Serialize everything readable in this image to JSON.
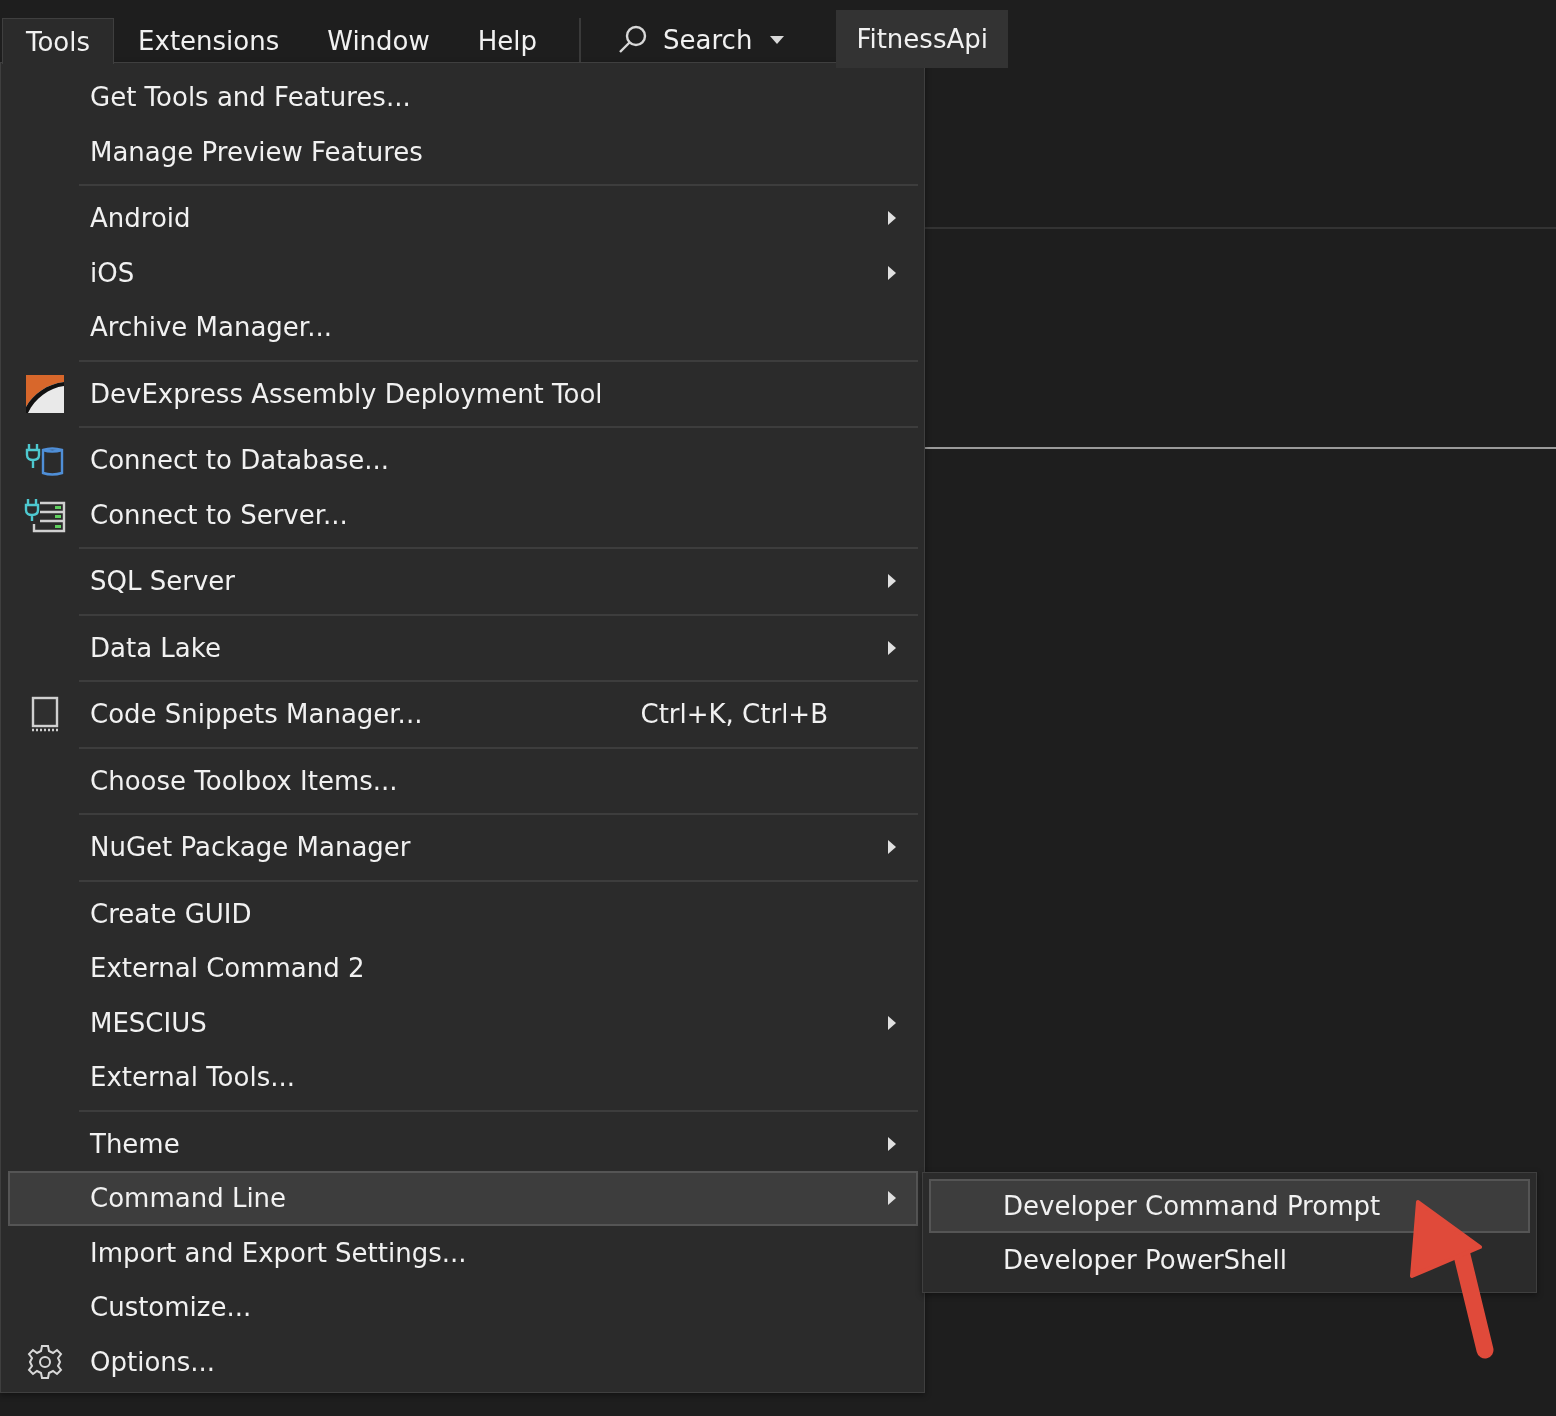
{
  "menubar": {
    "items": [
      {
        "label": "Tools",
        "selected": true
      },
      {
        "label": "Extensions",
        "selected": false
      },
      {
        "label": "Window",
        "selected": false
      },
      {
        "label": "Help",
        "selected": false
      }
    ],
    "search": {
      "label": "Search"
    },
    "solution_title": "FitnessApi"
  },
  "tools_menu": {
    "items": [
      {
        "kind": "item",
        "label": "Get Tools and Features...",
        "selected": false
      },
      {
        "kind": "item",
        "label": "Manage Preview Features",
        "selected": false
      },
      {
        "kind": "separator"
      },
      {
        "kind": "item",
        "label": "Android",
        "submenu": true,
        "selected": false
      },
      {
        "kind": "item",
        "label": "iOS",
        "submenu": true,
        "selected": false
      },
      {
        "kind": "item",
        "label": "Archive Manager...",
        "selected": false
      },
      {
        "kind": "separator"
      },
      {
        "kind": "item",
        "label": "DevExpress Assembly Deployment Tool",
        "selected": false
      },
      {
        "kind": "separator"
      },
      {
        "kind": "item",
        "label": "Connect to Database...",
        "selected": false
      },
      {
        "kind": "item",
        "label": "Connect to Server...",
        "selected": false
      },
      {
        "kind": "separator"
      },
      {
        "kind": "item",
        "label": "SQL Server",
        "submenu": true,
        "selected": false
      },
      {
        "kind": "separator"
      },
      {
        "kind": "item",
        "label": "Data Lake",
        "submenu": true,
        "selected": false
      },
      {
        "kind": "separator"
      },
      {
        "kind": "item",
        "label": "Code Snippets Manager...",
        "shortcut": "Ctrl+K, Ctrl+B",
        "selected": false
      },
      {
        "kind": "separator"
      },
      {
        "kind": "item",
        "label": "Choose Toolbox Items...",
        "selected": false
      },
      {
        "kind": "separator"
      },
      {
        "kind": "item",
        "label": "NuGet Package Manager",
        "submenu": true,
        "selected": false
      },
      {
        "kind": "separator"
      },
      {
        "kind": "item",
        "label": "Create GUID",
        "selected": false
      },
      {
        "kind": "item",
        "label": "External Command 2",
        "selected": false
      },
      {
        "kind": "item",
        "label": "MESCIUS",
        "submenu": true,
        "selected": false
      },
      {
        "kind": "item",
        "label": "External Tools...",
        "selected": false
      },
      {
        "kind": "separator"
      },
      {
        "kind": "item",
        "label": "Theme",
        "submenu": true,
        "selected": false
      },
      {
        "kind": "item",
        "label": "Command Line",
        "submenu": true,
        "selected": true
      },
      {
        "kind": "item",
        "label": "Import and Export Settings...",
        "selected": false
      },
      {
        "kind": "item",
        "label": "Customize...",
        "selected": false
      },
      {
        "kind": "item",
        "label": "Options...",
        "selected": false
      }
    ]
  },
  "command_line_submenu": {
    "items": [
      {
        "kind": "item",
        "label": "Developer Command Prompt",
        "selected": true
      },
      {
        "kind": "item",
        "label": "Developer PowerShell",
        "selected": false
      }
    ]
  }
}
